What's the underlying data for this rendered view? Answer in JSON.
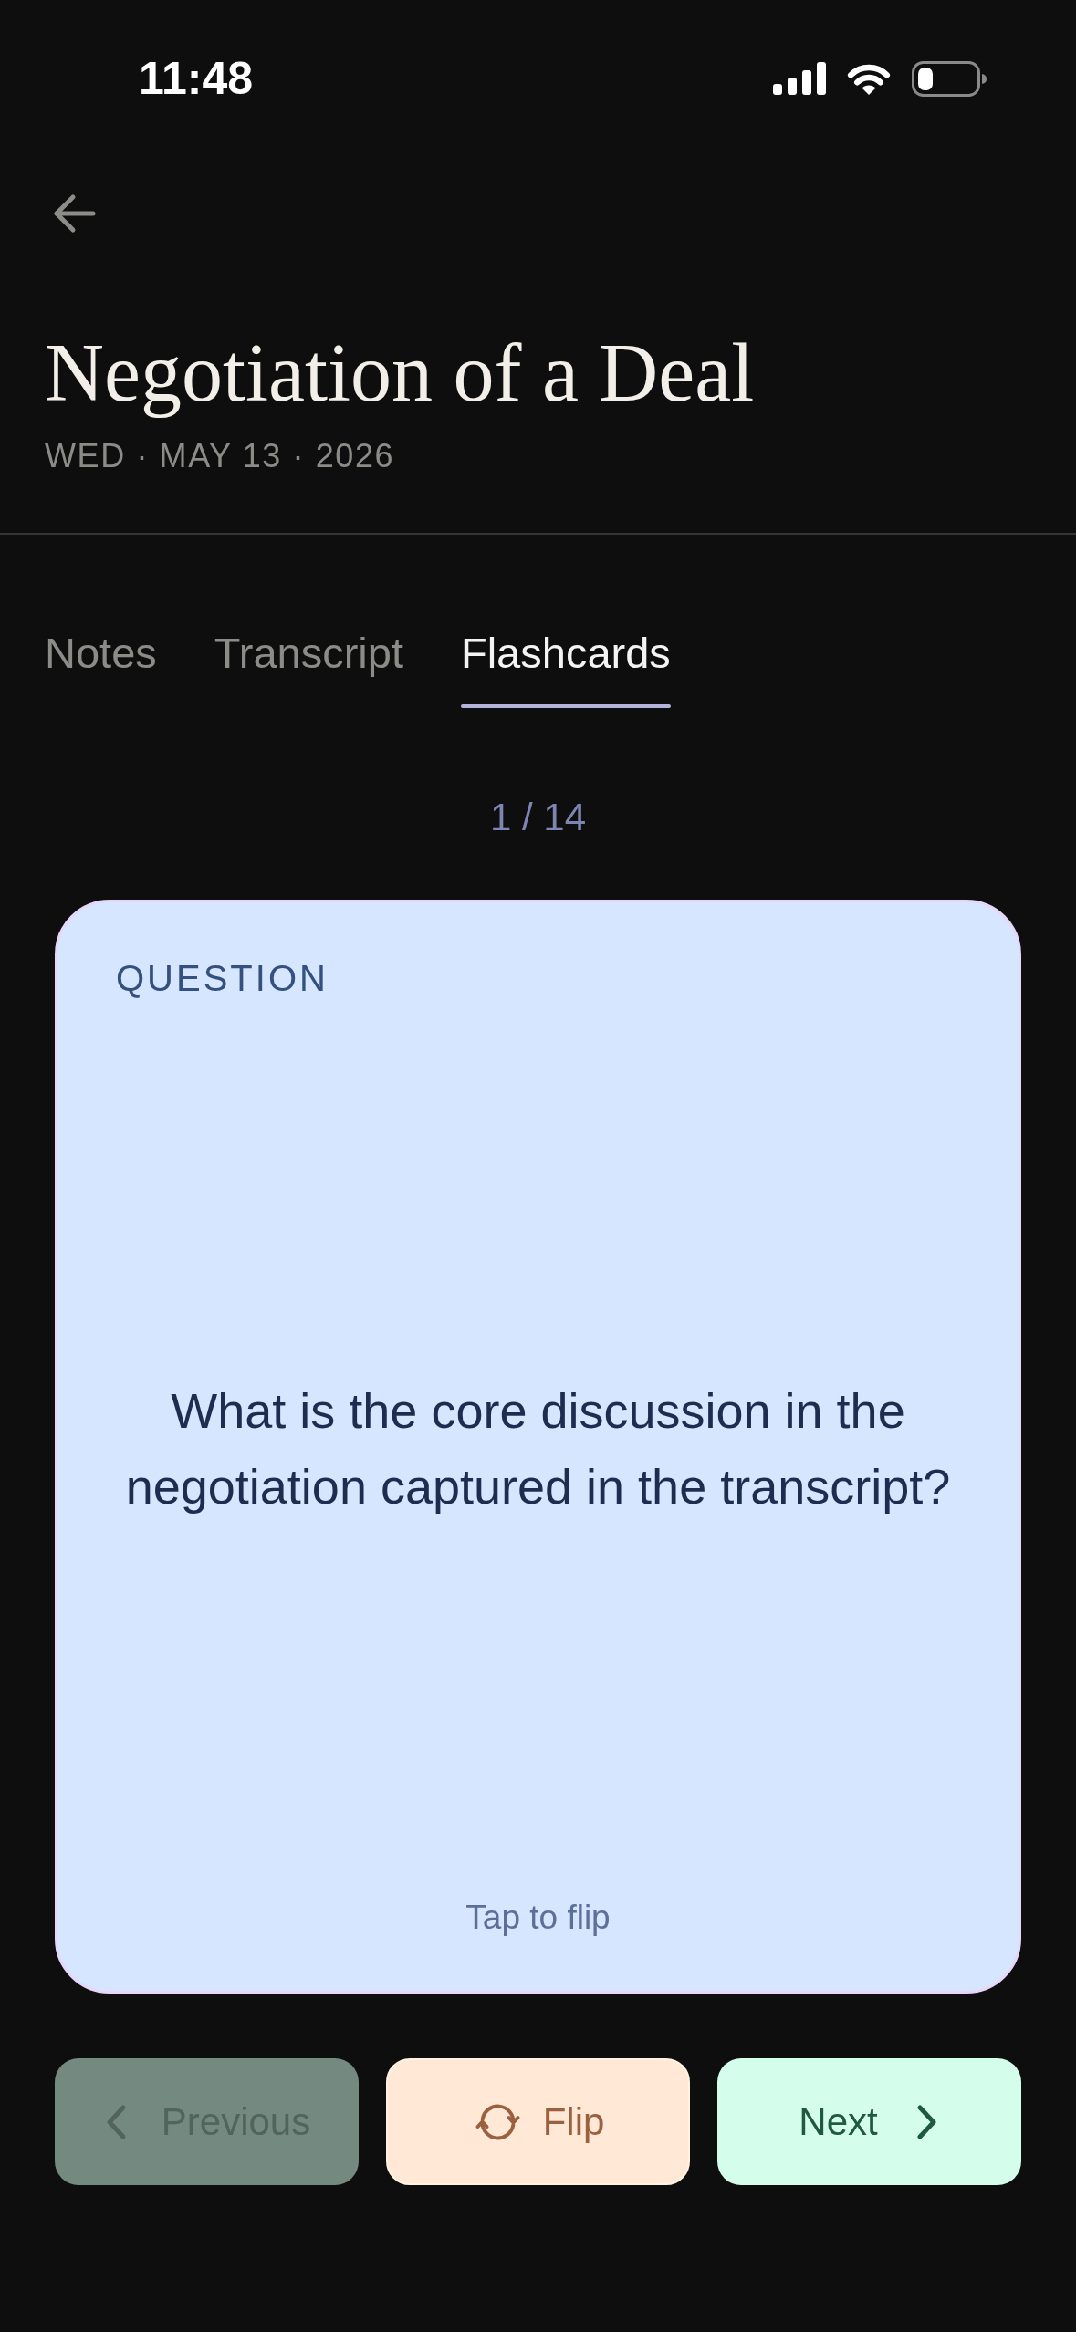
{
  "status_bar": {
    "time": "11:48"
  },
  "header": {
    "title": "Negotiation of a Deal",
    "date": "WED · MAY 13 · 2026"
  },
  "tabs": [
    {
      "label": "Notes",
      "selected": false
    },
    {
      "label": "Transcript",
      "selected": false
    },
    {
      "label": "Flashcards",
      "selected": true
    }
  ],
  "counter": "1 / 14",
  "card": {
    "side_label": "QUESTION",
    "text": "What is the core discussion in the negotiation captured in the transcript?",
    "hint": "Tap to flip"
  },
  "buttons": [
    {
      "kind": "previous",
      "label": "Previous",
      "disabled": true
    },
    {
      "kind": "flip",
      "label": "Flip",
      "disabled": false
    },
    {
      "kind": "next",
      "label": "Next",
      "disabled": false
    }
  ]
}
